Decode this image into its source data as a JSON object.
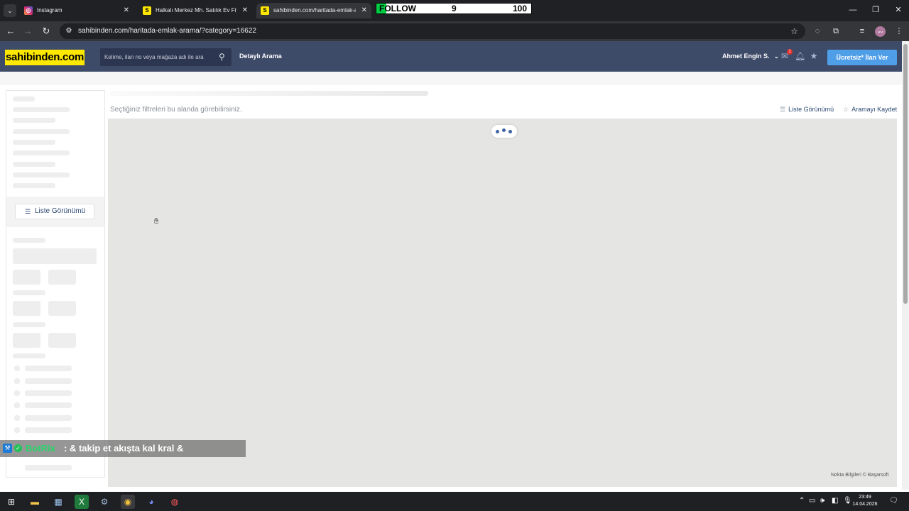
{
  "browser": {
    "tabs": [
      {
        "title": "Instagram",
        "favicon": "instagram-icon",
        "active": false
      },
      {
        "title": "Halkalı Merkez Mh. Satılık Ev Fiyatl",
        "favicon": "S",
        "active": false
      },
      {
        "title": "sahibinden.com/haritada-emlak-ar",
        "favicon": "S",
        "active": true
      }
    ],
    "url": "sahibinden.com/haritada-emlak-arama/?category=16622",
    "profile_initial": "ᴗᴗ"
  },
  "overlay_follow": {
    "label": "FOLLOW",
    "value": "9",
    "goal": "100"
  },
  "header": {
    "logo": "sahibinden.com",
    "search_placeholder": "Kelime, ilan no veya mağaza adı ile ara",
    "detailed_search": "Detaylı Arama",
    "user_name": "Ahmet Engin S.",
    "message_badge": "1",
    "post_button": "Ücretsiz* İlan Ver"
  },
  "content": {
    "filter_hint": "Seçtiğiniz filtreleri bu alanda görebilirsiniz.",
    "list_view": "Liste Görünümü",
    "save_search": "Aramayı Kaydet",
    "sidebar_list_view": "Liste Görünümü",
    "map_attribution": "Nokta Bilgileri © Başarsoft"
  },
  "chat_overlay": {
    "bot": "BotRix",
    "message": ": & takip et akışta kal kral &"
  },
  "taskbar": {
    "time": "23:49",
    "date": "14.04.2026"
  },
  "colors": {
    "site_header": "#3e4b68",
    "logo_bg": "#ffe800",
    "post_button": "#4f9ee8",
    "link": "#2e4a73",
    "map_bg": "#e5e5e3"
  }
}
